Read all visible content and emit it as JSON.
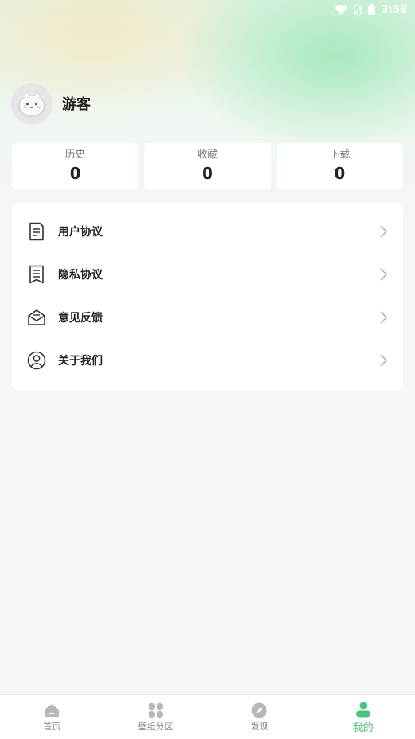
{
  "status_bar": {
    "time": "3:58"
  },
  "profile": {
    "username": "游客"
  },
  "stats": [
    {
      "label": "历史",
      "value": "0"
    },
    {
      "label": "收藏",
      "value": "0"
    },
    {
      "label": "下载",
      "value": "0"
    }
  ],
  "menu": [
    {
      "label": "用户协议",
      "icon": "document-icon"
    },
    {
      "label": "隐私协议",
      "icon": "bookmark-list-icon"
    },
    {
      "label": "意见反馈",
      "icon": "envelope-icon"
    },
    {
      "label": "关于我们",
      "icon": "user-circle-icon"
    }
  ],
  "tabbar": {
    "items": [
      {
        "label": "首页",
        "icon": "home-icon"
      },
      {
        "label": "壁纸分区",
        "icon": "grid-icon"
      },
      {
        "label": "发现",
        "icon": "compass-icon"
      },
      {
        "label": "我的",
        "icon": "person-icon"
      }
    ],
    "active_index": 3
  },
  "colors": {
    "accent": "#4cc37c",
    "page_bg": "#f6f6f6"
  }
}
